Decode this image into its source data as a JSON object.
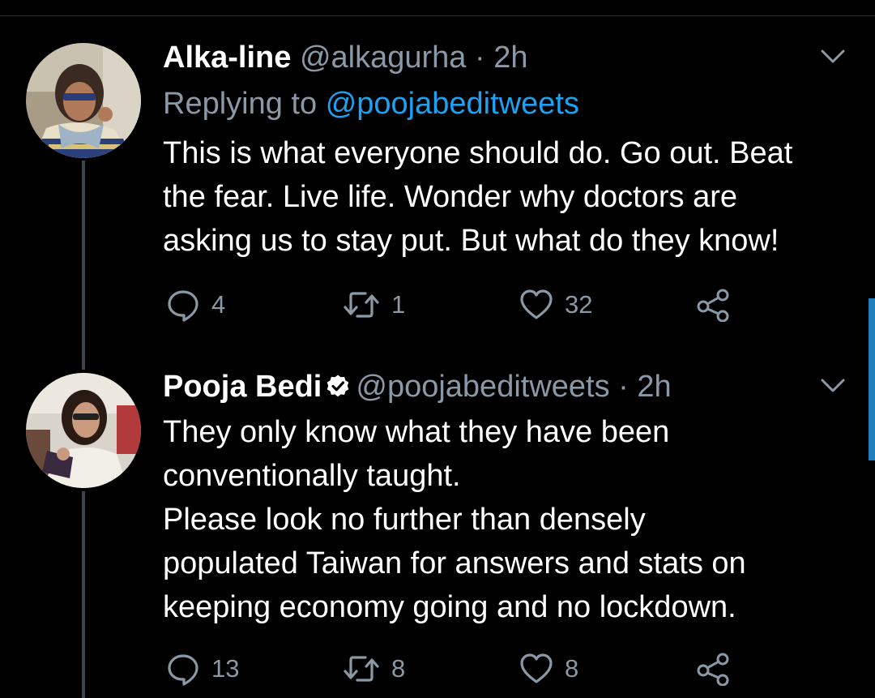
{
  "colors": {
    "background": "#000000",
    "primary_text": "#ffffff",
    "secondary_text": "#8b98a5",
    "accent": "#1da1f2",
    "thread_line": "#3d4348"
  },
  "tweets": [
    {
      "name": "Alka-line",
      "handle": "@alkagurha",
      "separator": "·",
      "time": "2h",
      "verified": false,
      "replying_prefix": "Replying to",
      "replying_to": "@poojabeditweets",
      "text": "This is what everyone should do. Go out. Beat\nthe fear. Live life. Wonder why doctors are\nasking us to stay put. But what do they know!",
      "replies": "4",
      "retweets": "1",
      "likes": "32",
      "icons": [
        "reply-icon",
        "retweet-icon",
        "like-icon",
        "share-icon"
      ]
    },
    {
      "name": "Pooja Bedi",
      "handle": "@poojabeditweets",
      "separator": "·",
      "time": "2h",
      "verified": true,
      "text": "They only know what they have been\nconventionally taught.\nPlease look no further than densely\npopulated  Taiwan for answers and stats on\nkeeping economy going and no lockdown.",
      "replies": "13",
      "retweets": "8",
      "likes": "8",
      "icons": [
        "reply-icon",
        "retweet-icon",
        "like-icon",
        "share-icon"
      ]
    }
  ]
}
